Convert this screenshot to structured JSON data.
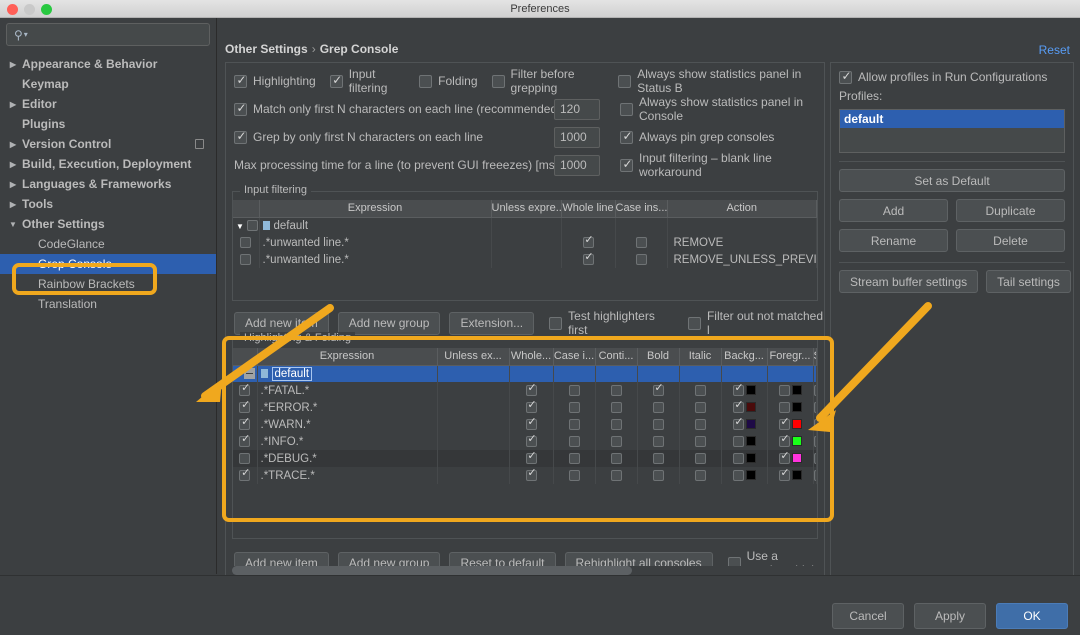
{
  "window": {
    "title": "Preferences"
  },
  "sidebar": {
    "search_placeholder": "",
    "items": [
      {
        "label": "Appearance & Behavior",
        "arrow": "▶",
        "bold": true,
        "indent": false,
        "selected": false
      },
      {
        "label": "Keymap",
        "arrow": "",
        "bold": true,
        "indent": false,
        "selected": false
      },
      {
        "label": "Editor",
        "arrow": "▶",
        "bold": true,
        "indent": false,
        "selected": false
      },
      {
        "label": "Plugins",
        "arrow": "",
        "bold": true,
        "indent": false,
        "selected": false
      },
      {
        "label": "Version Control",
        "arrow": "▶",
        "bold": true,
        "indent": false,
        "selected": false
      },
      {
        "label": "Build, Execution, Deployment",
        "arrow": "▶",
        "bold": true,
        "indent": false,
        "selected": false
      },
      {
        "label": "Languages & Frameworks",
        "arrow": "▶",
        "bold": true,
        "indent": false,
        "selected": false
      },
      {
        "label": "Tools",
        "arrow": "▶",
        "bold": true,
        "indent": false,
        "selected": false
      },
      {
        "label": "Other Settings",
        "arrow": "▼",
        "bold": true,
        "indent": false,
        "selected": false
      },
      {
        "label": "CodeGlance",
        "arrow": "",
        "bold": false,
        "indent": true,
        "selected": false
      },
      {
        "label": "Grep Console",
        "arrow": "",
        "bold": false,
        "indent": true,
        "selected": true
      },
      {
        "label": "Rainbow Brackets",
        "arrow": "",
        "bold": false,
        "indent": true,
        "selected": false
      },
      {
        "label": "Translation",
        "arrow": "",
        "bold": false,
        "indent": true,
        "selected": false
      }
    ],
    "help_label": "?"
  },
  "header": {
    "breadcrumb_parent": "Other Settings",
    "breadcrumb_sep": "›",
    "breadcrumb_current": "Grep Console",
    "reset_label": "Reset"
  },
  "options": {
    "row1": [
      {
        "label": "Highlighting",
        "checked": true
      },
      {
        "label": "Input filtering",
        "checked": true
      },
      {
        "label": "Folding",
        "checked": false
      },
      {
        "label": "Filter before grepping",
        "checked": false
      },
      {
        "label": "Always show statistics panel in Status B",
        "checked": false
      }
    ],
    "row2": {
      "label": "Match only first N characters on each line (recommended)",
      "checked": true,
      "value": "120",
      "right_label": "Always show statistics panel in Console",
      "right_checked": false
    },
    "row3": {
      "label": "Grep by only first N characters on each line",
      "checked": true,
      "value": "1000",
      "right_label": "Always pin grep consoles",
      "right_checked": true
    },
    "row4": {
      "label": "Max processing time for a line (to prevent GUI freeezes) [ms]",
      "checked": null,
      "value": "1000",
      "right_label": "Input filtering – blank line workaround",
      "right_checked": true
    }
  },
  "input_filtering": {
    "group_title": "Input filtering",
    "columns": [
      "",
      "Expression",
      "Unless expre...",
      "Whole line",
      "Case ins...",
      "Action"
    ],
    "rows": [
      {
        "kind": "group",
        "tri": "▼",
        "enabled": false,
        "expression": "default",
        "unless": "",
        "whole_line": null,
        "case_ins": null,
        "action": ""
      },
      {
        "kind": "item",
        "tri": "",
        "enabled": false,
        "expression": ".*unwanted line.*",
        "unless": "",
        "whole_line": true,
        "case_ins": false,
        "action": "REMOVE"
      },
      {
        "kind": "item",
        "tri": "",
        "enabled": false,
        "expression": ".*unwanted line.*",
        "unless": "",
        "whole_line": true,
        "case_ins": false,
        "action": "REMOVE_UNLESS_PREVIOUSLY_"
      }
    ],
    "buttons": [
      "Add new item",
      "Add new group",
      "Extension..."
    ],
    "checkboxes": [
      {
        "label": "Test highlighters first",
        "checked": false
      },
      {
        "label": "Filter out not matched l",
        "checked": false
      }
    ]
  },
  "highlighting": {
    "group_title": "Highlighting & Folding",
    "columns": [
      "",
      "Expression",
      "Unless ex...",
      "Whole...",
      "Case i...",
      "Conti...",
      "Bold",
      "Italic",
      "Backg...",
      "Foregr...",
      "Sta"
    ],
    "rows": [
      {
        "kind": "group",
        "tri": "▼",
        "enabled": null,
        "expression": "default",
        "whole": null,
        "case_i": null,
        "conti": null,
        "bold": null,
        "italic": null,
        "bg_checked": null,
        "bg_color": "",
        "fg_checked": null,
        "fg_color": "",
        "selected": true
      },
      {
        "kind": "item",
        "tri": "",
        "enabled": true,
        "expression": ".*FATAL.*",
        "whole": true,
        "case_i": false,
        "conti": false,
        "bold": true,
        "italic": false,
        "bg_checked": true,
        "bg_color": "#000000",
        "fg_checked": false,
        "fg_color": "#000000",
        "selected": false
      },
      {
        "kind": "item",
        "tri": "",
        "enabled": true,
        "expression": ".*ERROR.*",
        "whole": true,
        "case_i": false,
        "conti": false,
        "bold": false,
        "italic": false,
        "bg_checked": true,
        "bg_color": "#4a0b0b",
        "fg_checked": false,
        "fg_color": "#000000",
        "selected": false
      },
      {
        "kind": "item",
        "tri": "",
        "enabled": true,
        "expression": ".*WARN.*",
        "whole": true,
        "case_i": false,
        "conti": false,
        "bold": false,
        "italic": false,
        "bg_checked": true,
        "bg_color": "#1e0a46",
        "fg_checked": true,
        "fg_color": "#ff0000",
        "selected": false
      },
      {
        "kind": "item",
        "tri": "",
        "enabled": true,
        "expression": ".*INFO.*",
        "whole": true,
        "case_i": false,
        "conti": false,
        "bold": false,
        "italic": false,
        "bg_checked": false,
        "bg_color": "#000000",
        "fg_checked": true,
        "fg_color": "#1aff1a",
        "selected": false
      },
      {
        "kind": "item",
        "tri": "",
        "enabled": false,
        "expression": ".*DEBUG.*",
        "whole": true,
        "case_i": false,
        "conti": false,
        "bold": false,
        "italic": false,
        "bg_checked": false,
        "bg_color": "#000000",
        "fg_checked": true,
        "fg_color": "#ff33dd",
        "selected": false
      },
      {
        "kind": "item",
        "tri": "",
        "enabled": true,
        "expression": ".*TRACE.*",
        "whole": true,
        "case_i": false,
        "conti": false,
        "bold": false,
        "italic": false,
        "bg_checked": false,
        "bg_color": "#000000",
        "fg_checked": true,
        "fg_color": "#000000",
        "selected": false
      }
    ],
    "buttons": [
      "Add new item",
      "Add new group",
      "Reset to default",
      "Rehighlight all consoles"
    ],
    "checkbox": {
      "label": "Use a previous higl",
      "checked": false
    }
  },
  "profiles_panel": {
    "allow_label": "Allow profiles in Run Configurations",
    "allow_checked": true,
    "profiles_label": "Profiles:",
    "profiles": [
      "default"
    ],
    "set_default_label": "Set as Default",
    "add_label": "Add",
    "duplicate_label": "Duplicate",
    "rename_label": "Rename",
    "delete_label": "Delete",
    "stream_buffer_label": "Stream buffer settings",
    "tail_label": "Tail settings"
  },
  "footer": {
    "cancel_label": "Cancel",
    "apply_label": "Apply",
    "ok_label": "OK"
  },
  "colors": {
    "accent_blue": "#2d5faf",
    "annotation_orange": "#f0a81e",
    "link_blue": "#589df6",
    "bg": "#3c3f41"
  }
}
